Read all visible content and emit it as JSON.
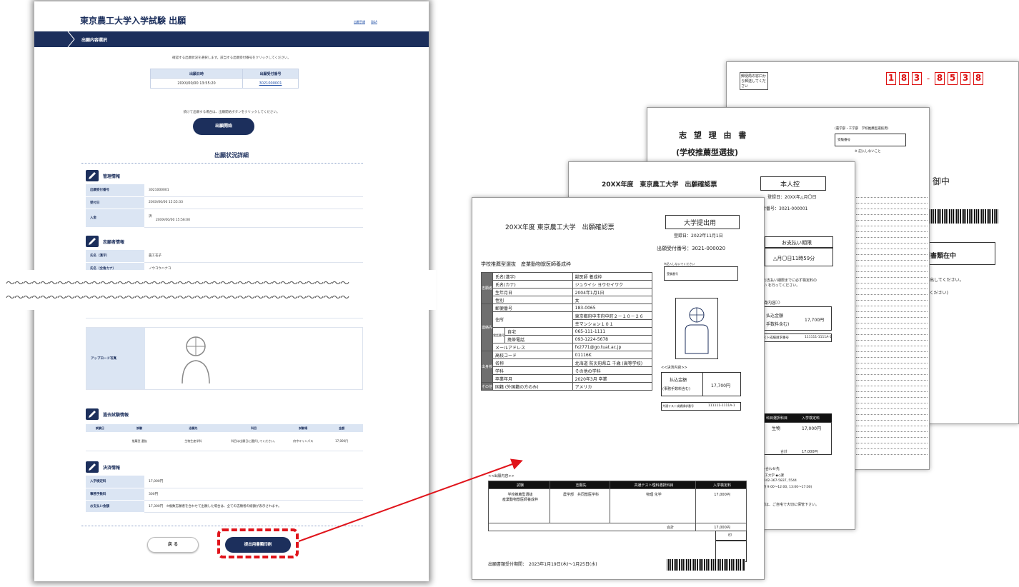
{
  "browser": {
    "site_title": "東京農工大学入学試験 出願",
    "header_links": [
      "出願手順",
      "Q&A"
    ],
    "section_label": "出願内容選択",
    "note1": "確認する出願状況を選択します。該当する出願受付番号をクリックしてください。",
    "select_table": {
      "headers": [
        "出願日時",
        "出願受付番号"
      ],
      "row": [
        "20XX/00/00 13:55:20",
        "3021000001"
      ]
    },
    "note2": "続けて出願する場合は、出願開始ボタンをクリックしてください。",
    "start_button": "出願開始",
    "detail_title": "出願状況詳細",
    "admin": {
      "title": "管理情報",
      "rows": [
        {
          "label": "出願受付番号",
          "value": "3021000001"
        },
        {
          "label": "受付日",
          "value": "20XX/00/00 15:55:33"
        },
        {
          "label": "入金",
          "value": "済",
          "value2": "20XX/00/00 15:56:00"
        }
      ]
    },
    "applicant": {
      "title": "志願者情報",
      "rows": [
        {
          "label": "氏名（漢字）",
          "value": "農工花子"
        },
        {
          "label": "氏名（全角カナ）",
          "value": "ノウコウハナコ"
        }
      ]
    },
    "wave": "〜〜〜〜〜〜〜〜〜〜〜〜〜〜〜〜〜〜〜〜〜〜〜〜〜〜〜〜〜〜〜〜〜〜〜〜〜〜〜〜",
    "upload_label": "アップロード写真",
    "past": {
      "title": "過去試験情報",
      "headers": [
        "試験日",
        "試験",
        "志願先",
        "科目",
        "試験場",
        "金額"
      ],
      "row": [
        "",
        "推薦型\n選抜",
        "生物生産学科",
        "科目は出願日に選択してください。",
        "府中キャンパス",
        "17,000円"
      ]
    },
    "payment": {
      "title": "決済情報",
      "rows": [
        {
          "label": "入学検定料",
          "value": "17,000円"
        },
        {
          "label": "事務手数料",
          "value": "300円"
        },
        {
          "label": "お支払い金額",
          "value": "17,300円　※複数志願者を合わせて出願した場合は、全ての志願者の総額が表示されます。"
        }
      ]
    },
    "back_button": "戻 る",
    "print_button": "提出用書類印刷"
  },
  "colors": {
    "navy": "#1c2f5c",
    "highlight": "#e0141b",
    "header_fill": "#dbe5f3"
  },
  "documents": {
    "envelope": {
      "postal": [
        "1",
        "8",
        "3",
        "8",
        "5",
        "3",
        "8"
      ],
      "stamp_note": "郵便局の窓口から郵送してください",
      "addressee": "課 御中",
      "enclosed": "願書類在中",
      "note1": "て提出してください。",
      "note2": "してください)"
    },
    "reason": {
      "title": "志 望 理 由 書",
      "subtitle": "(学校推薦型選抜)",
      "right_header": "(農学部・工学部　学校推薦型選抜用)",
      "exam_no_label": "受験番号",
      "exam_no_note": "※ 記入しないこと"
    },
    "confirm_back": {
      "title": "20XX年度　東京農工大学　出願確認票",
      "copy_label": "本人控",
      "reg_date": "登録日：20XX年△月〇日",
      "receipt_no": "付番号：3021-000001",
      "pay_deadline_label": "お支払い期限",
      "pay_deadline": "△月〇日11時59分",
      "pay_note": "お支払い期限までに必ず検定料の\nい を行ってください。",
      "settle_label": "済内容〉〉",
      "paid_label": "払込金額",
      "fee_note": "手数料含む)",
      "paid_value": "17,700円",
      "test_no_label": "スト成績請求番号",
      "test_no": "111111-1111A-1",
      "subject_hdr": "科目選択科目",
      "fee_hdr": "入学検定料",
      "subject": "生物",
      "fee": "17,000円",
      "total_label": "合計",
      "total": "17,000円",
      "contact_label": "い合わせ先",
      "contact1": "農工大学 ◆◇課",
      "contact2": "l 042-367-5837, 5544",
      "contact3": "(時 9:00〜12:00, 13:00〜17:00)",
      "keep_note": "理は、ご自宅で大切に保管下さい。"
    },
    "confirm_front": {
      "title": "20XX年度 東京農工大学　出願確認票",
      "copy_label": "大学提出用",
      "reg_date": "登録日：2022年11月1日",
      "receipt_no": "出願受付番号：3021-000020",
      "course": "学校推薦型選抜　産業動物獣医師養成枠",
      "exam_no_note": "※記入しないでください",
      "exam_no_label": "受験番号",
      "side_labels": [
        "志願者",
        "連絡先",
        "出身校",
        "その他"
      ],
      "rows": [
        {
          "label": "氏名(漢字)",
          "value": "獣医師 養成枠"
        },
        {
          "label": "氏名(カナ)",
          "value": "ジュウイシ ヨウセイワク"
        },
        {
          "label": "生年月日",
          "value": "2004年1月1日"
        },
        {
          "label": "性別",
          "value": "女"
        },
        {
          "label": "郵便番号",
          "value": "183-0065"
        },
        {
          "label": "住所",
          "value": "東京都府中市府中町２－１０－２６"
        },
        {
          "label": "",
          "value": "幸マンション１０１"
        },
        {
          "label": "自宅",
          "value": "065-111-1111"
        },
        {
          "label": "携帯電話",
          "value": "093-1224-5678"
        },
        {
          "label": "メールアドレス",
          "value": "fx2771@go.tuat.ac.jp"
        },
        {
          "label": "高校コード",
          "value": "01116K"
        },
        {
          "label": "名称",
          "value": "北海道 防災府県立 千歳 (高等学校)"
        },
        {
          "label": "学科",
          "value": "その他の学科"
        },
        {
          "label": "卒業年月",
          "value": "2020年3月 卒業"
        },
        {
          "label": "国籍 (外国籍の方のみ)",
          "value": "アメリカ"
        }
      ],
      "phone_sub": "電話番号",
      "settle_label": "<<決済内容>>",
      "paid_label": "払込金額",
      "fee_note": "(事務手数料含む)",
      "paid_value": "17,700円",
      "test_no_label": "共通テスト成績請求番号",
      "test_no": "111111-1111A-1",
      "apply_label": "<<出願内容>>",
      "apply_headers": [
        "試験",
        "志願先",
        "共通テスト理科選択科目",
        "入学検定料"
      ],
      "apply_row": [
        "学校推薦型選抜\n産業動物獣医師養成枠",
        "農学部　共同獣医学科",
        "物理 化学",
        "17,000円"
      ],
      "total_label": "合計",
      "total": "17,000円",
      "mark": "印",
      "period": "出願書類受付期間：　2023年1月19日(木)〜1月25日(水)"
    }
  }
}
